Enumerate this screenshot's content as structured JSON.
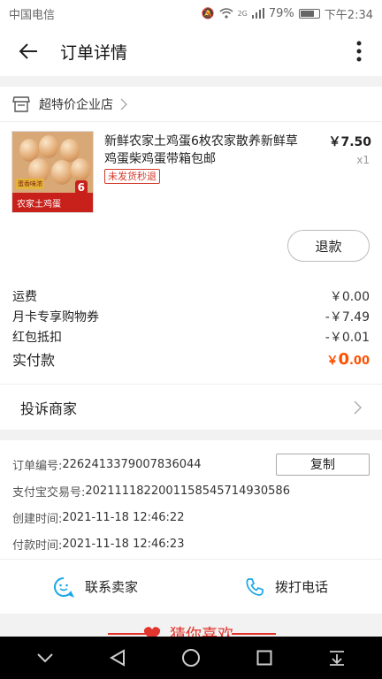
{
  "status_bar": {
    "carrier": "中国电信",
    "network": "2G",
    "battery": "79%",
    "time": "下午2:34"
  },
  "header": {
    "title": "订单详情"
  },
  "shop": {
    "name": "超特价企业店"
  },
  "product": {
    "name": "新鲜农家土鸡蛋6枚农家散养新鲜草鸡蛋柴鸡蛋带箱包邮",
    "badge": "未发货秒退",
    "price": "￥7.50",
    "quantity": "x1",
    "image_band_text": "农家土鸡蛋",
    "image_count": "6",
    "image_tag": "蛋香味浓"
  },
  "refund_button": "退款",
  "costs": [
    {
      "label": "运费",
      "value": "￥0.00"
    },
    {
      "label": "月卡专享购物券",
      "value": "-￥7.49"
    },
    {
      "label": "红包抵扣",
      "value": "-￥0.01"
    }
  ],
  "total": {
    "label": "实付款",
    "currency": "￥",
    "integer": "0",
    "decimal": ".00"
  },
  "complain": {
    "label": "投诉商家"
  },
  "order_info": {
    "order_no_label": "订单编号:",
    "order_no": "2262413379007836044",
    "copy_label": "复制",
    "alipay_label": "支付宝交易号:",
    "alipay_no": "2021111822001158545714930586",
    "created_label": "创建时间:",
    "created": "2021-11-18 12:46:22",
    "paid_label": "付款时间:",
    "paid": "2021-11-18 12:46:23"
  },
  "contact": {
    "seller_label": "联系卖家",
    "phone_label": "拨打电话"
  },
  "guess": {
    "title": "猜你喜欢"
  },
  "colors": {
    "accent": "#ff5000",
    "red": "#e2352d",
    "contact_icon": "#1aa6e8"
  },
  "icons": [
    "back-arrow-icon",
    "more-vertical-icon",
    "shop-icon",
    "chevron-right-icon",
    "chat-icon",
    "phone-icon",
    "heart-icon",
    "nav-down-icon",
    "nav-back-icon",
    "nav-home-icon",
    "nav-recent-icon",
    "nav-drawer-icon"
  ]
}
